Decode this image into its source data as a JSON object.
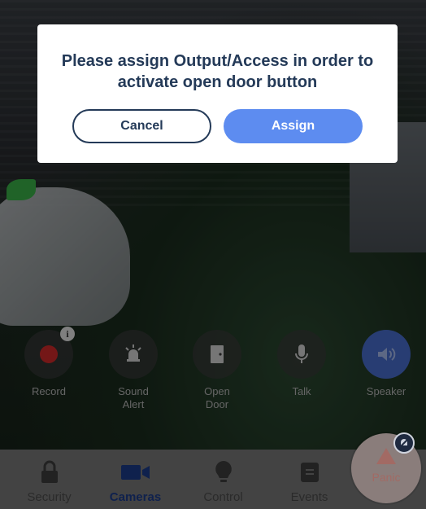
{
  "dialog": {
    "message": "Please assign Output/Access in order to activate open door button",
    "cancel_label": "Cancel",
    "assign_label": "Assign"
  },
  "controls": [
    {
      "label": "Record",
      "icon": "record-icon"
    },
    {
      "label": "Sound\nAlert",
      "icon": "siren-icon"
    },
    {
      "label": "Open\nDoor",
      "icon": "door-icon"
    },
    {
      "label": "Talk",
      "icon": "microphone-icon"
    },
    {
      "label": "Speaker",
      "icon": "speaker-icon"
    }
  ],
  "record_badge": "i",
  "nav": {
    "items": [
      {
        "label": "Security",
        "icon": "lock-icon",
        "active": false
      },
      {
        "label": "Cameras",
        "icon": "video-camera-icon",
        "active": true
      },
      {
        "label": "Control",
        "icon": "lightbulb-icon",
        "active": false
      },
      {
        "label": "Events",
        "icon": "events-list-icon",
        "active": false
      }
    ],
    "panic_label": "Panic"
  },
  "colors": {
    "accent": "#5d8cf0",
    "dialog_text": "#243a58",
    "record_red": "#d42b2b",
    "nav_active": "#1d3c8c",
    "speaker_active": "#4a6fd1"
  }
}
